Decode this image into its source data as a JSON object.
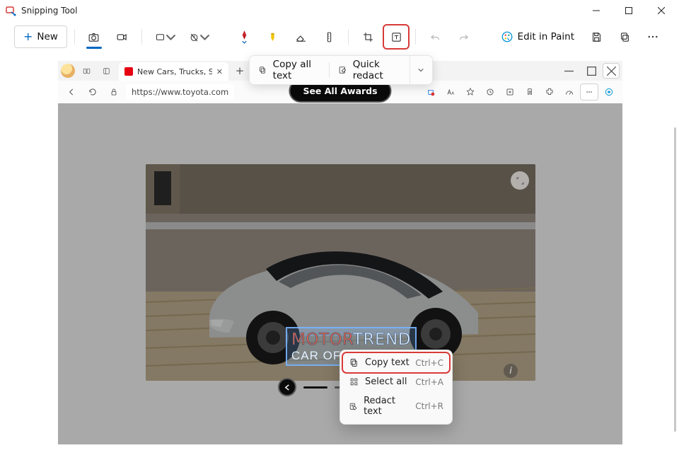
{
  "window": {
    "title": "Snipping Tool"
  },
  "toolbar": {
    "new_label": "New",
    "edit_in_paint_label": "Edit in Paint"
  },
  "text_actions_popup": {
    "copy_all_text_label": "Copy all text",
    "quick_redact_label": "Quick redact"
  },
  "context_menu": {
    "copy_text": {
      "label": "Copy text",
      "shortcut": "Ctrl+C"
    },
    "select_all": {
      "label": "Select all",
      "shortcut": "Ctrl+A"
    },
    "redact_text": {
      "label": "Redact text",
      "shortcut": "Ctrl+R"
    }
  },
  "screenshot": {
    "tab_title": "New Cars, Trucks, SUVs & Hybrid",
    "url": "https://www.toyota.com",
    "see_awards_label": "See All Awards",
    "motortrend": {
      "line1_a": "MOTOR",
      "line1_b": "TREND",
      "line2": "CAR OF THE"
    },
    "info_char": "i"
  }
}
